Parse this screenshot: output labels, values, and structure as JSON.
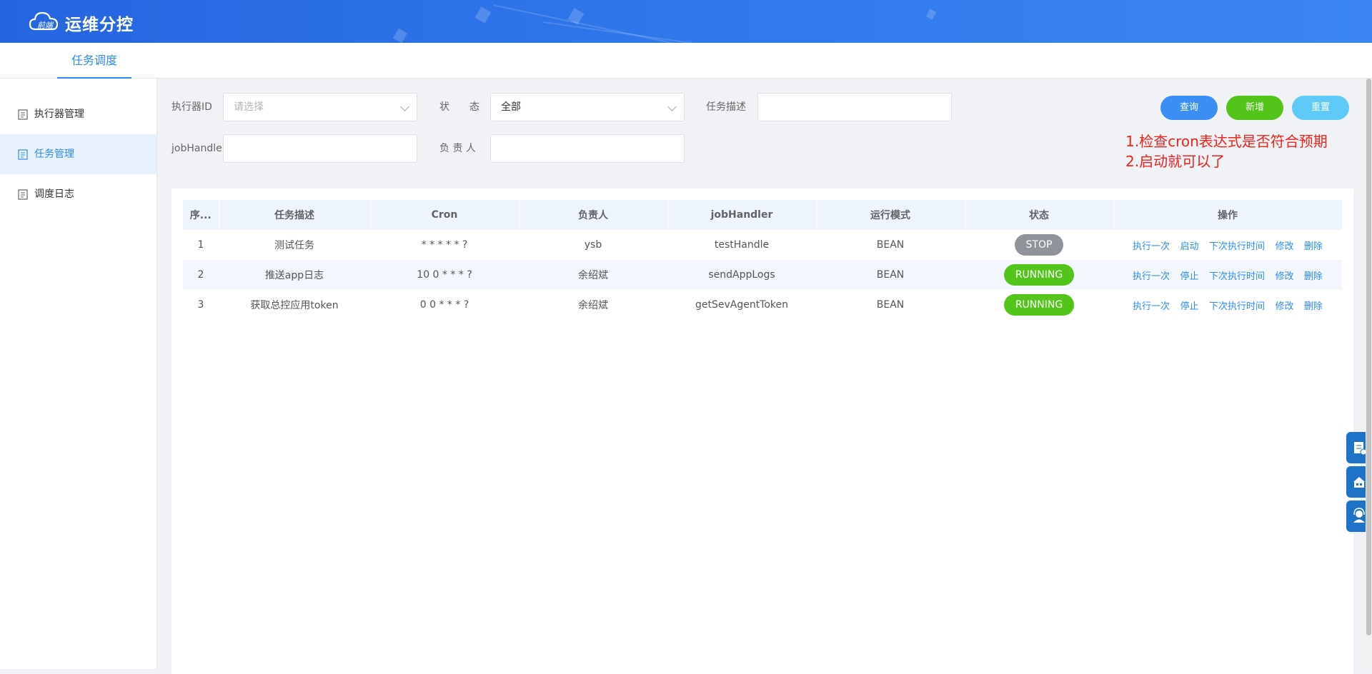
{
  "header": {
    "app_title": "运维分控",
    "logo_text": "前端"
  },
  "nav": {
    "tabs": [
      {
        "label": "任务调度",
        "active": true
      }
    ]
  },
  "sidebar": {
    "items": [
      {
        "label": "执行器管理",
        "active": false
      },
      {
        "label": "任务管理",
        "active": true
      },
      {
        "label": "调度日志",
        "active": false
      }
    ]
  },
  "filters": {
    "executor_label": "执行器ID",
    "executor_placeholder": "请选择",
    "status_label": "状　　态",
    "status_value": "全部",
    "desc_label": "任务描述",
    "desc_value": "",
    "jobhandler_label": "jobHandler",
    "jobhandler_value": "",
    "owner_label": "负 责 人",
    "owner_value": ""
  },
  "buttons": {
    "query": "查询",
    "add": "新增",
    "reset": "重置"
  },
  "annotation": {
    "line1": "1.检查cron表达式是否符合预期",
    "line2": "2.启动就可以了"
  },
  "table": {
    "columns": [
      "序...",
      "任务描述",
      "Cron",
      "负责人",
      "jobHandler",
      "运行模式",
      "状态",
      "操作"
    ],
    "rows": [
      {
        "index": "1",
        "desc": "测试任务",
        "cron": "* * * * * ?",
        "owner": "ysb",
        "handler": "testHandle",
        "mode": "BEAN",
        "status": "STOP",
        "ops": [
          "执行一次",
          "启动",
          "下次执行时间",
          "修改",
          "删除"
        ]
      },
      {
        "index": "2",
        "desc": "推送app日志",
        "cron": "10 0 * * * ?",
        "owner": "余绍斌",
        "handler": "sendAppLogs",
        "mode": "BEAN",
        "status": "RUNNING",
        "ops": [
          "执行一次",
          "停止",
          "下次执行时间",
          "修改",
          "删除"
        ]
      },
      {
        "index": "3",
        "desc": "获取总控应用token",
        "cron": "0 0 * * * ?",
        "owner": "余绍斌",
        "handler": "getSevAgentToken",
        "mode": "BEAN",
        "status": "RUNNING",
        "ops": [
          "执行一次",
          "停止",
          "下次执行时间",
          "修改",
          "删除"
        ]
      }
    ]
  },
  "colors": {
    "primary": "#2d8cf0",
    "success": "#52c41a",
    "info": "#909399",
    "annotation": "#f0221b"
  }
}
